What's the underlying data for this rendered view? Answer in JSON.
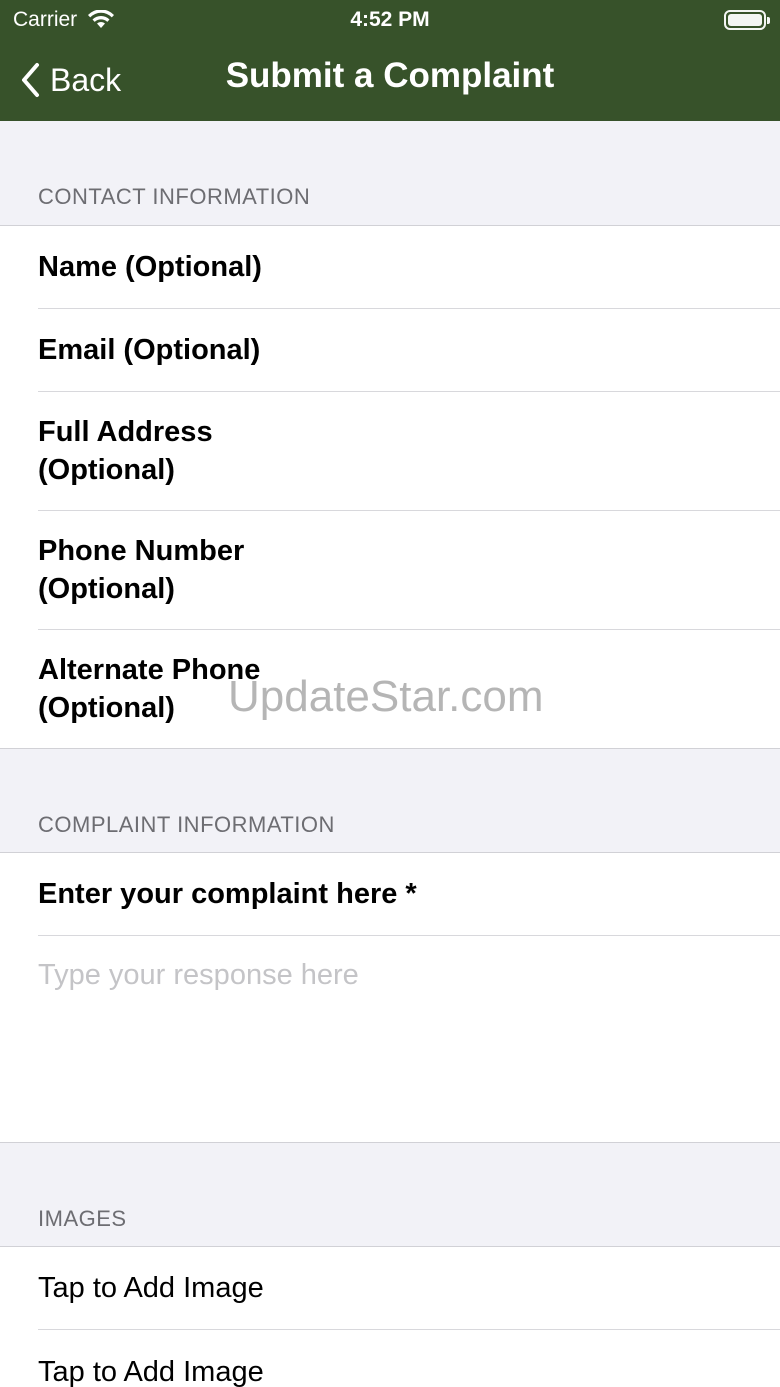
{
  "status": {
    "carrier": "Carrier",
    "time": "4:52 PM"
  },
  "nav": {
    "back_label": "Back",
    "title": "Submit a Complaint"
  },
  "contact": {
    "header": "CONTACT INFORMATION",
    "fields": [
      {
        "label": "Name (Optional)"
      },
      {
        "label": "Email (Optional)"
      },
      {
        "label": "Full Address (Optional)"
      },
      {
        "label": "Phone Number (Optional)"
      },
      {
        "label": "Alternate Phone (Optional)"
      }
    ]
  },
  "complaint": {
    "header": "COMPLAINT INFORMATION",
    "label": "Enter your complaint here *",
    "placeholder": "Type your response here"
  },
  "images": {
    "header": "IMAGES",
    "items": [
      {
        "label": "Tap to Add Image"
      },
      {
        "label": "Tap to Add Image"
      }
    ]
  },
  "watermark": "UpdateStar.com"
}
